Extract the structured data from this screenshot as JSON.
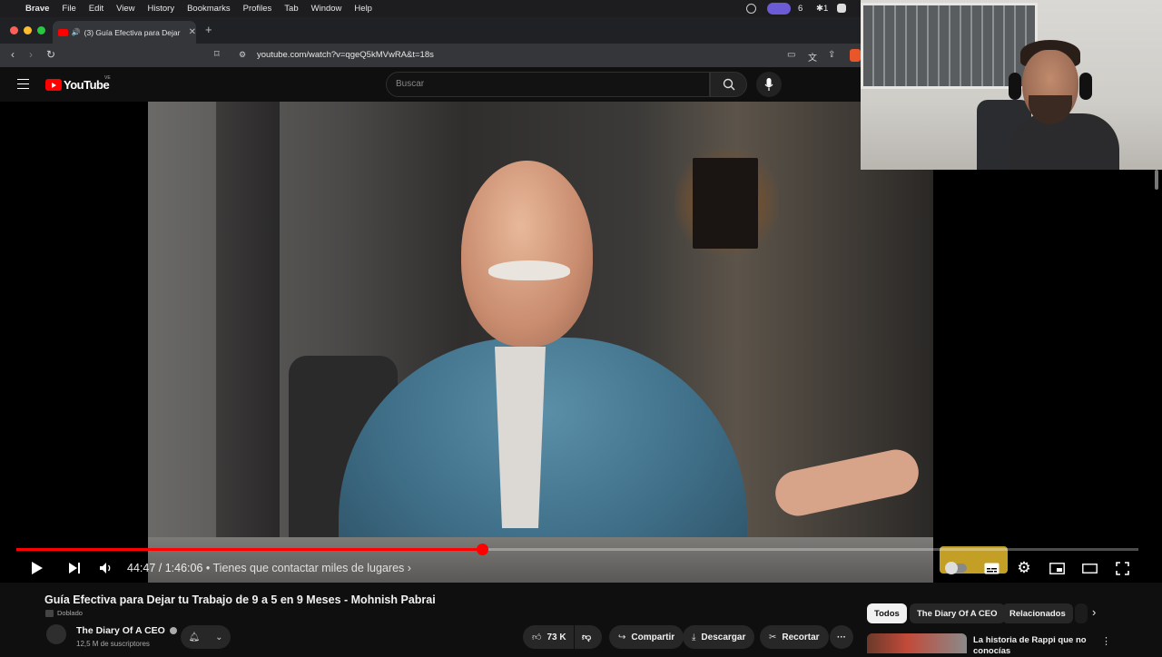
{
  "menubar": {
    "app_name": "Brave",
    "items": [
      "File",
      "Edit",
      "View",
      "History",
      "Bookmarks",
      "Profiles",
      "Tab",
      "Window",
      "Help"
    ],
    "status_count": "6",
    "status_star": "✱1"
  },
  "browser": {
    "tab_title": "(3) Guía Efectiva para Dejar",
    "url": "youtube.com/watch?v=qgeQ5kMVwRA&t=18s"
  },
  "youtube": {
    "logo_text": "YouTube",
    "country_code": "VE",
    "search_placeholder": "Buscar"
  },
  "player": {
    "current_time": "44:47",
    "duration": "1:46:06",
    "time_display": "44:47 / 1:46:06",
    "chapter_text": "• Tienes que contactar miles de lugares ›",
    "progress_fraction": 0.415
  },
  "video": {
    "title": "Guía Efectiva para Dejar tu Trabajo de 9 a 5 en 9 Meses - Mohnish Pabrai",
    "dubbed_label": "Doblado",
    "channel_name": "The Diary Of A CEO",
    "subscribers": "12,5 M de suscriptores",
    "likes": "73 K",
    "share_label": "Compartir",
    "download_label": "Descargar",
    "clip_label": "Recortar",
    "more_label": "···"
  },
  "sidebar": {
    "chips": [
      "Todos",
      "The Diary Of A CEO",
      "Relacionados"
    ],
    "rec_title": "La historia de Rappi que no conocías"
  },
  "colors": {
    "accent": "#ff0000",
    "background": "#0f0f0f",
    "chip_active": "#f1f1f1"
  }
}
